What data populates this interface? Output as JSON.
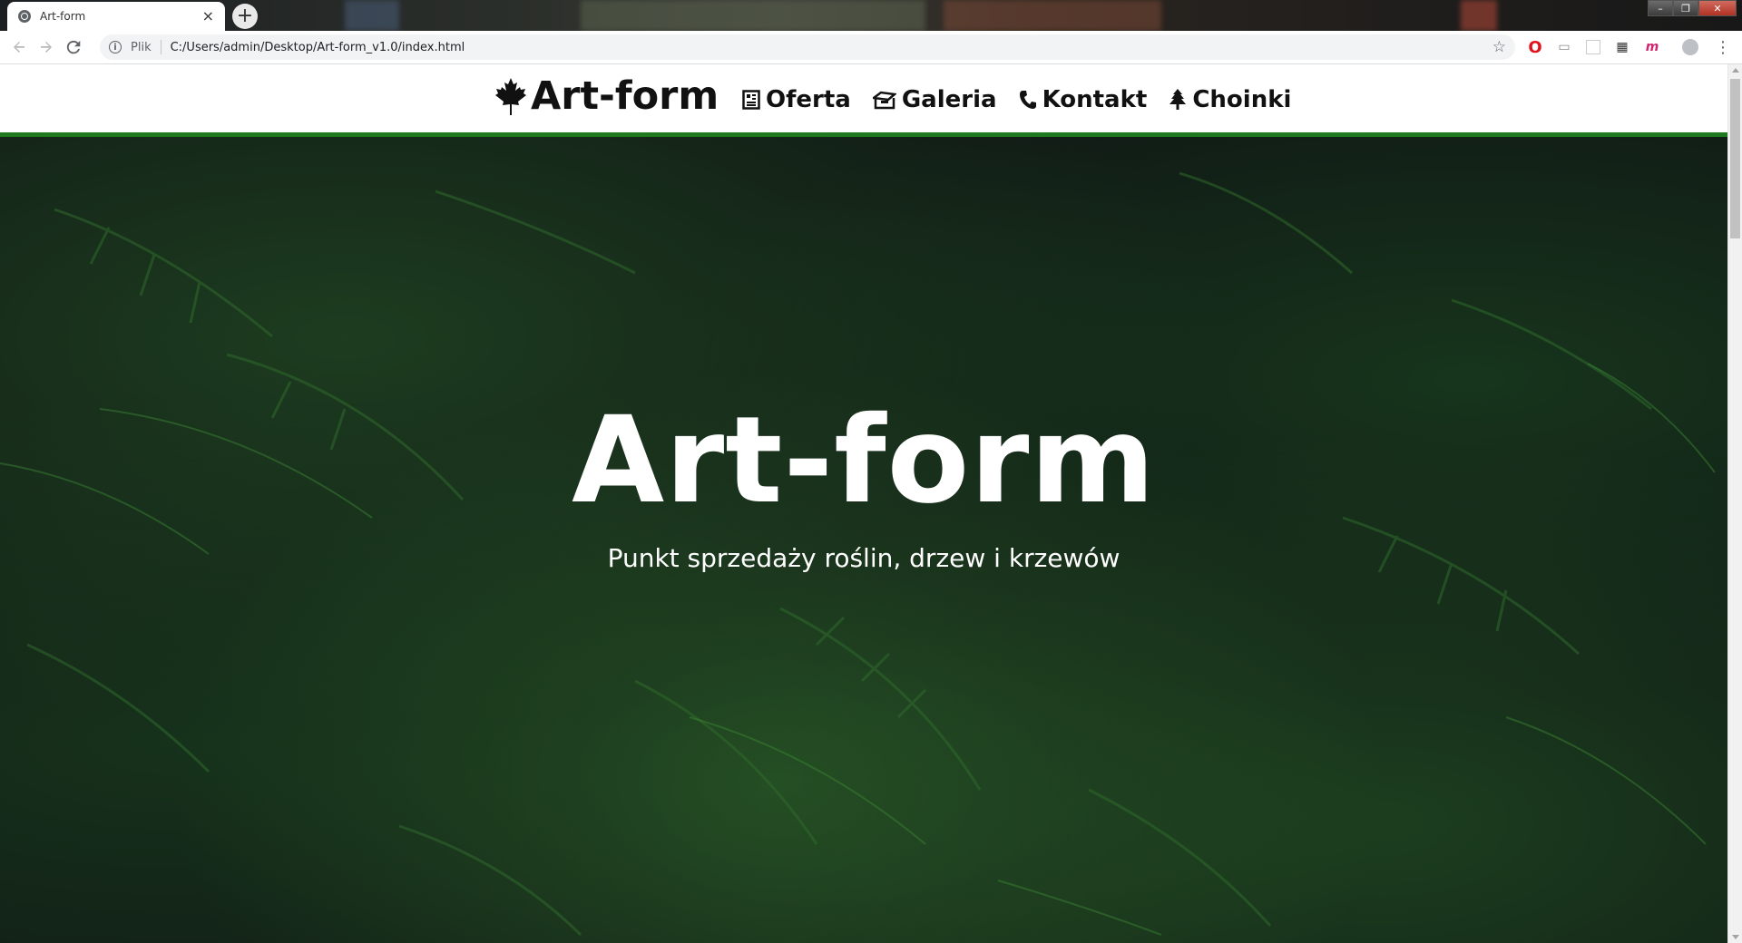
{
  "browser": {
    "tab_title": "Art-form",
    "tab_close": "×",
    "new_tab": "+",
    "scheme_label": "Plik",
    "url": "C:/Users/admin/Desktop/Art-form_v1.0/index.html",
    "window_controls": {
      "minimize": "–",
      "restore": "❐",
      "close": "✕"
    }
  },
  "site": {
    "logo_text": "Art-form",
    "nav": [
      {
        "label": "Oferta",
        "icon": "newspaper-icon"
      },
      {
        "label": "Galeria",
        "icon": "box-open-icon"
      },
      {
        "label": "Kontakt",
        "icon": "phone-icon"
      },
      {
        "label": "Choinki",
        "icon": "tree-icon"
      }
    ],
    "accent_color": "#1f7a1f"
  },
  "hero": {
    "title": "Art-form",
    "subtitle": "Punkt sprzedaży roślin, drzew i krzewów"
  }
}
